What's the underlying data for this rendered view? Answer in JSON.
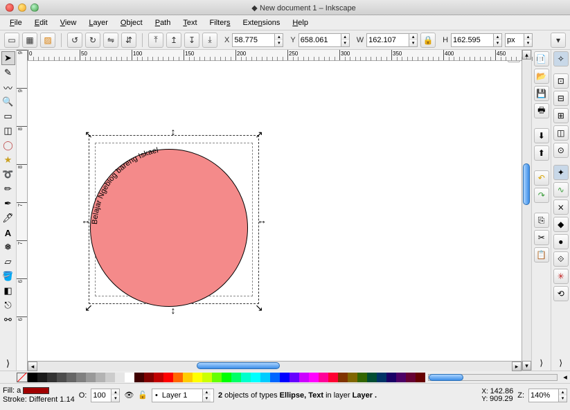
{
  "window": {
    "title": "New document 1 – Inkscape",
    "icon": "◆"
  },
  "menu": [
    "File",
    "Edit",
    "View",
    "Layer",
    "Object",
    "Path",
    "Text",
    "Filters",
    "Extensions",
    "Help"
  ],
  "coords": {
    "x": "58.775",
    "y": "658.061",
    "w": "162.107",
    "h": "162.595",
    "unit": "px"
  },
  "hruler_labels": [
    {
      "v": "0",
      "p": 0
    },
    {
      "v": "50",
      "p": 75
    },
    {
      "v": "100",
      "p": 150
    },
    {
      "v": "150",
      "p": 225
    },
    {
      "v": "200",
      "p": 300
    },
    {
      "v": "250",
      "p": 375
    },
    {
      "v": "300",
      "p": 450
    },
    {
      "v": "350",
      "p": 525
    },
    {
      "v": "400",
      "p": 600
    },
    {
      "v": "450",
      "p": 675
    }
  ],
  "vruler_labels": [
    {
      "v": "9",
      "p": 0
    },
    {
      "v": "9",
      "p": 55
    },
    {
      "v": "8",
      "p": 110
    },
    {
      "v": "8",
      "p": 165
    },
    {
      "v": "7",
      "p": 220
    },
    {
      "v": "7",
      "p": 275
    },
    {
      "v": "6",
      "p": 330
    },
    {
      "v": "6",
      "p": 385
    }
  ],
  "curved_text": "Belajar Ngeblog bareng Iskael",
  "palette": [
    "#000000",
    "#1a1a1a",
    "#333333",
    "#4d4d4d",
    "#666666",
    "#808080",
    "#999999",
    "#b3b3b3",
    "#cccccc",
    "#e6e6e6",
    "#ffffff",
    "#400000",
    "#800000",
    "#c00000",
    "#ff0000",
    "#ff6600",
    "#ffcc00",
    "#ffff00",
    "#ccff00",
    "#66ff00",
    "#00ff00",
    "#00ff66",
    "#00ffcc",
    "#00ffff",
    "#00ccff",
    "#0066ff",
    "#0000ff",
    "#6600ff",
    "#cc00ff",
    "#ff00ff",
    "#ff0099",
    "#ff0033",
    "#803300",
    "#806600",
    "#336600",
    "#004d33",
    "#003366",
    "#1a0066",
    "#4d0066",
    "#660033",
    "#660000"
  ],
  "status": {
    "fill_label": "Fill:",
    "fill_text": "a",
    "stroke_label": "Stroke:",
    "stroke_text": "Different 1.14",
    "opacity_label": "O:",
    "opacity": "100",
    "layer": "Layer 1",
    "desc_pre": "2",
    "desc_mid": " objects of types ",
    "desc_types": "Ellipse, Text",
    "desc_in": " in layer ",
    "desc_layer": "Layer .",
    "coord_x": "142.86",
    "coord_y": "909.29",
    "zoom_label": "Z:",
    "zoom": "140%"
  }
}
